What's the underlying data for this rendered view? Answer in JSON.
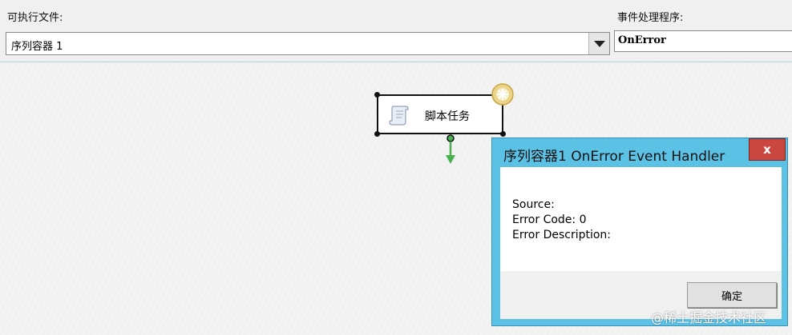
{
  "toolbar": {
    "executable_label": "可执行文件:",
    "executable_value": "序列容器 1",
    "event_handler_label": "事件处理程序:",
    "event_handler_value": "OnError"
  },
  "canvas": {
    "task_label": "脚本任务"
  },
  "dialog": {
    "title": "序列容器1 OnError Event Handler",
    "close_label": "x",
    "source_line": "Source:",
    "error_code_line": "Error Code: 0",
    "error_description_line": "Error Description:",
    "ok_label": "确定"
  },
  "watermark": "@稀土掘金技术社区",
  "colors": {
    "dialog_frame": "#5bc2e6",
    "close_button": "#c9473f",
    "connector_arrow": "#4caf50"
  }
}
